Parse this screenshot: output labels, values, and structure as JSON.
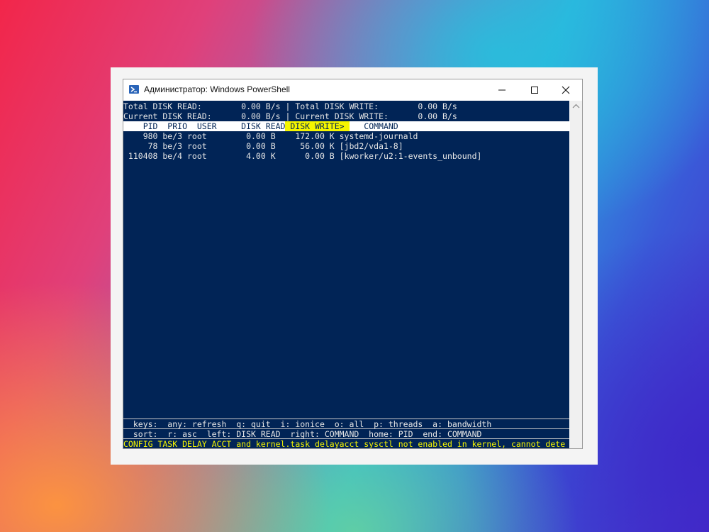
{
  "window": {
    "title": "Администратор: Windows PowerShell",
    "icon": "powershell-icon",
    "controls": [
      "minimize-icon",
      "maximize-icon",
      "close-icon"
    ]
  },
  "summary": {
    "total_read": "Total DISK READ:        0.00 B/s | Total DISK WRITE:        0.00 B/s",
    "current_read": "Current DISK READ:      0.00 B/s | Current DISK WRITE:      0.00 B/s"
  },
  "header": {
    "left": "    PID  PRIO  USER     DISK READ",
    "sorted": " DISK WRITE> ",
    "right": "   COMMAND"
  },
  "processes": [
    {
      "text": "    980 be/3 root        0.00 B    172.00 K systemd-journald"
    },
    {
      "text": "     78 be/3 root        0.00 B     56.00 K [jbd2/vda1-8]"
    },
    {
      "text": " 110408 be/4 root        4.00 K      0.00 B [kworker/u2:1-events_unbound]"
    }
  ],
  "footer": {
    "keys": "  keys:  any: refresh  q: quit  i: ionice  o: all  p: threads  a: bandwidth",
    "sort": "  sort:  r: asc  left: DISK READ  right: COMMAND  home: PID  end: COMMAND",
    "warning": "CONFIG_TASK_DELAY_ACCT and kernel.task_delayacct sysctl not enabled in kernel, cannot dete"
  },
  "colors": {
    "console_bg": "#012456",
    "highlight": "#f5f500"
  }
}
